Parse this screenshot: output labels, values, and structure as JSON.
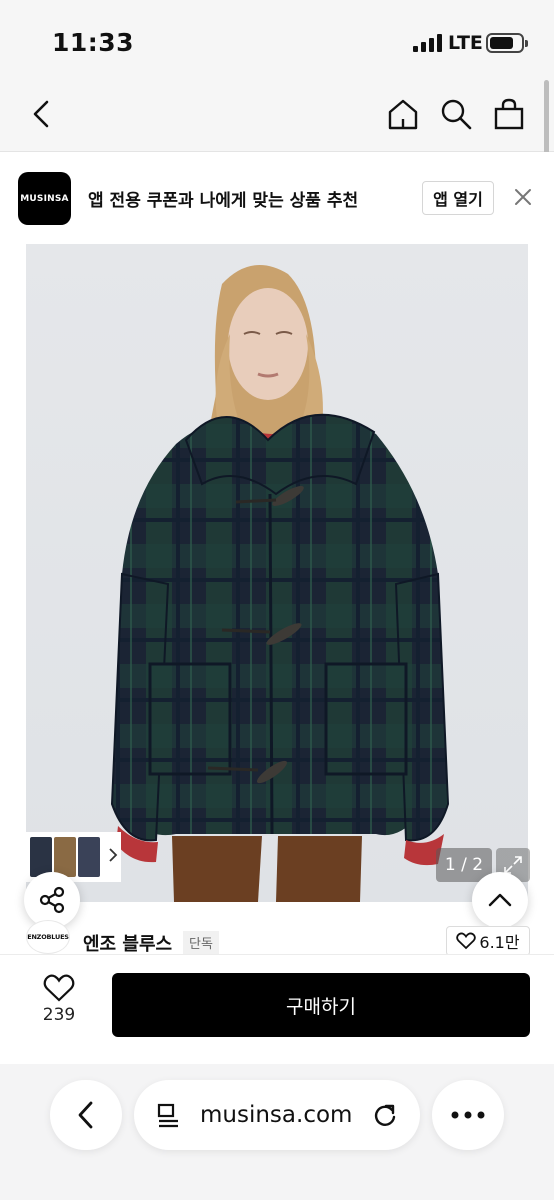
{
  "status_bar": {
    "time": "11:33",
    "network": "LTE",
    "battery_level": 0.75
  },
  "nav": {
    "icons": [
      "back-icon",
      "home-icon",
      "search-icon",
      "bag-icon"
    ]
  },
  "app_banner": {
    "logo_text": "MUSINSA",
    "message": "앱 전용 쿠폰과 나에게 맞는 상품 추천",
    "open_button": "앱 열기",
    "close_icon": "close-icon"
  },
  "product": {
    "image_counter": "1 / 2",
    "brand_logo_text": "ENZOBLUES",
    "brand_name": "엔조 블루스",
    "exclusive_tag": "단독",
    "likes": "6.1만"
  },
  "purchase": {
    "wish_count": "239",
    "buy_label": "구매하기"
  },
  "browser": {
    "url": "musinsa.com"
  },
  "colors": {
    "accent": "#000000",
    "background": "#f6f6f6",
    "coat_green": "#1f3a37",
    "coat_navy": "#1c2436",
    "sweater_red": "#b8363a"
  }
}
